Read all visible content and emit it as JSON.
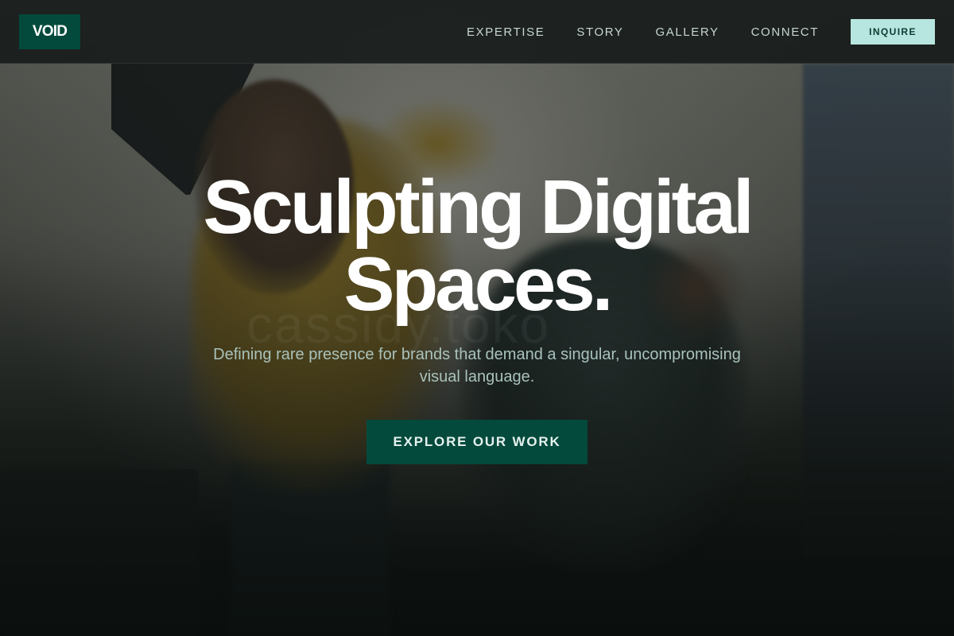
{
  "brand": {
    "logo_text": "VOID"
  },
  "nav": {
    "links": [
      {
        "label": "EXPERTISE"
      },
      {
        "label": "STORY"
      },
      {
        "label": "GALLERY"
      },
      {
        "label": "CONNECT"
      }
    ],
    "cta_label": "INQUIRE"
  },
  "hero": {
    "title_line1": "Sculpting Digital",
    "title_line2": "Spaces.",
    "subtitle": "Defining rare presence for brands that demand a singular, uncompromising visual language.",
    "cta_label": "EXPLORE OUR WORK",
    "watermark": "cassidy.toko"
  },
  "colors": {
    "accent": "#034a3c",
    "accent_light": "#b6e6df",
    "nav_text": "#c7d6d0",
    "subtitle_text": "#a9c2bb",
    "background": "#0d1210"
  }
}
